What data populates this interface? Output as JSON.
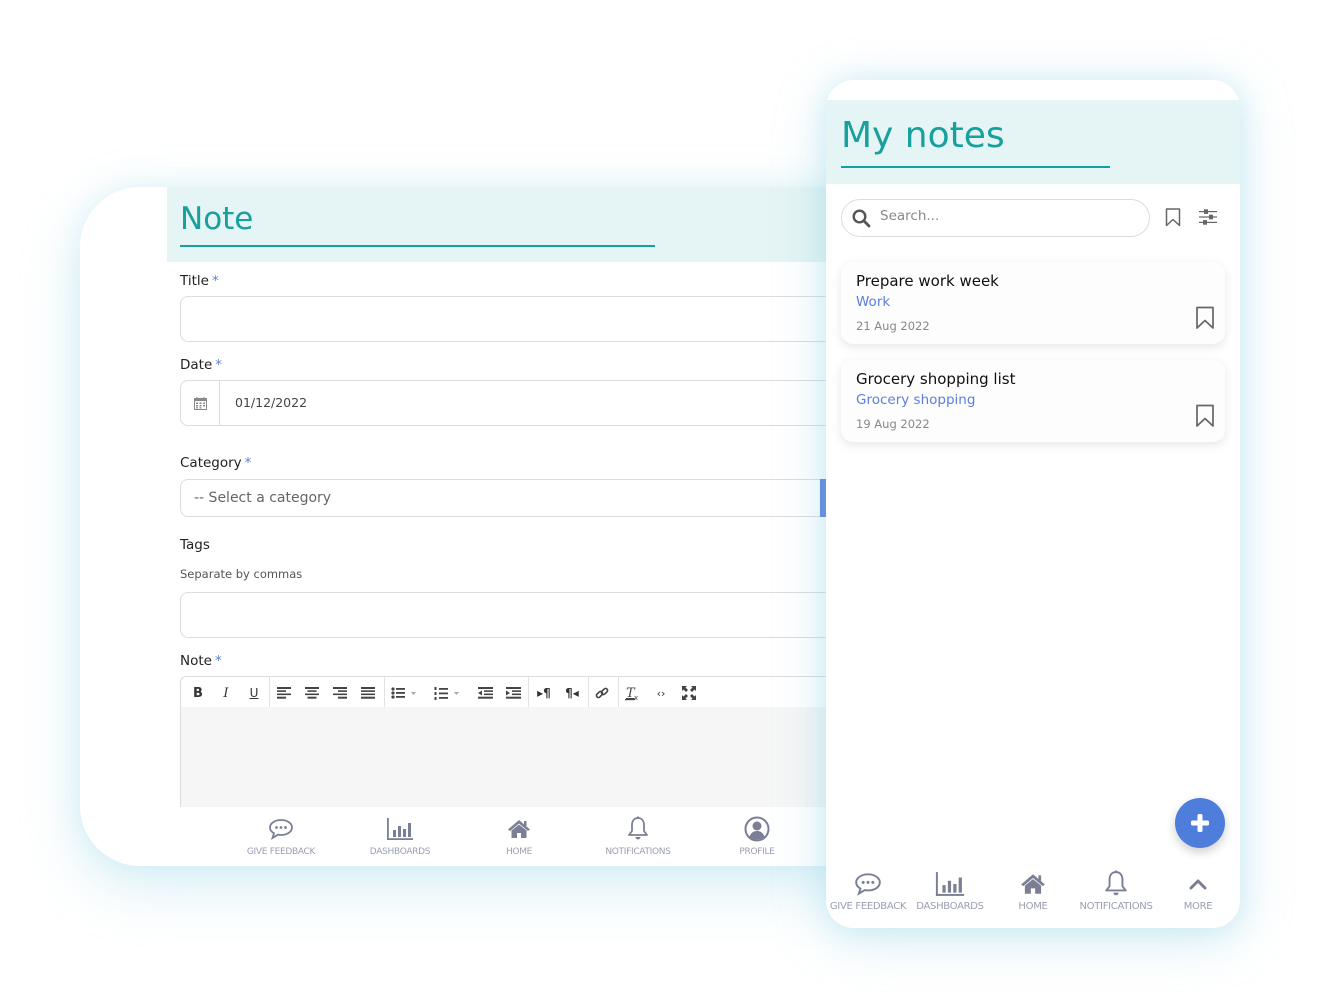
{
  "note_form": {
    "title": "Note",
    "fields": {
      "title": {
        "label": "Title",
        "required_mark": "*",
        "value": ""
      },
      "date": {
        "label": "Date",
        "required_mark": "*",
        "value": "01/12/2022",
        "icon": "calendar-icon"
      },
      "category": {
        "label": "Category",
        "required_mark": "*",
        "placeholder": "-- Select a category"
      },
      "tags": {
        "label": "Tags",
        "help": "Separate by commas",
        "value": ""
      },
      "note": {
        "label": "Note",
        "required_mark": "*",
        "value": ""
      }
    },
    "toolbar": {
      "bold": "B",
      "italic": "I",
      "underline": "U",
      "items": [
        "bold",
        "italic",
        "underline",
        "align-left",
        "align-center",
        "align-right",
        "align-justify",
        "bulleted-list",
        "numbered-list",
        "outdent",
        "indent",
        "ltr",
        "rtl",
        "link",
        "clear-format",
        "source-code",
        "fullscreen"
      ]
    },
    "bottom_nav": [
      {
        "label": "GIVE FEEDBACK",
        "icon": "chat-bubble-icon"
      },
      {
        "label": "DASHBOARDS",
        "icon": "bar-chart-icon"
      },
      {
        "label": "HOME",
        "icon": "home-icon"
      },
      {
        "label": "NOTIFICATIONS",
        "icon": "bell-icon"
      },
      {
        "label": "PROFILE",
        "icon": "user-circle-icon"
      }
    ]
  },
  "my_notes": {
    "title": "My notes",
    "search": {
      "placeholder": "Search...",
      "value": ""
    },
    "notes": [
      {
        "title": "Prepare work week",
        "category": "Work",
        "date": "21 Aug 2022"
      },
      {
        "title": "Grocery shopping list",
        "category": "Grocery shopping",
        "date": "19 Aug 2022"
      }
    ],
    "fab_label": "+",
    "bottom_nav": [
      {
        "label": "GIVE FEEDBACK",
        "icon": "chat-bubble-icon"
      },
      {
        "label": "DASHBOARDS",
        "icon": "bar-chart-icon"
      },
      {
        "label": "HOME",
        "icon": "home-icon"
      },
      {
        "label": "NOTIFICATIONS",
        "icon": "bell-icon"
      },
      {
        "label": "MORE",
        "icon": "chevron-up-icon"
      }
    ]
  },
  "colors": {
    "accent_teal": "#17a09c",
    "header_bg": "#e5f4f4",
    "link_blue": "#5b7fdc",
    "fab_blue": "#4f7ddc",
    "nav_gray": "#7b7f96"
  }
}
